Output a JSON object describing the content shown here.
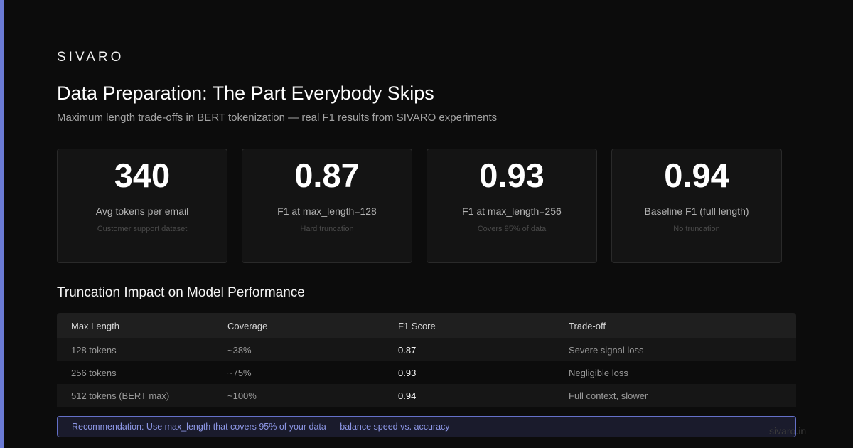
{
  "brand": "SIVARO",
  "title": "Data Preparation: The Part Everybody Skips",
  "subtitle": "Maximum length trade-offs in BERT tokenization — real F1 results from SIVARO experiments",
  "accent_color": "#6b7bd6",
  "stats": [
    {
      "value": "340",
      "label": "Avg tokens per email",
      "note": "Customer support dataset"
    },
    {
      "value": "0.87",
      "label": "F1 at max_length=128",
      "note": "Hard truncation"
    },
    {
      "value": "0.93",
      "label": "F1 at max_length=256",
      "note": "Covers 95% of data"
    },
    {
      "value": "0.94",
      "label": "Baseline F1 (full length)",
      "note": "No truncation"
    }
  ],
  "section_title": "Truncation Impact on Model Performance",
  "table": {
    "headers": [
      "Max Length",
      "Coverage",
      "F1 Score",
      "Trade-off"
    ],
    "rows": [
      [
        "128 tokens",
        "~38%",
        "0.87",
        "Severe signal loss"
      ],
      [
        "256 tokens",
        "~75%",
        "0.93",
        "Negligible loss"
      ],
      [
        "512 tokens (BERT max)",
        "~100%",
        "0.94",
        "Full context, slower"
      ]
    ]
  },
  "recommendation": "Recommendation: Use max_length that covers 95% of your data — balance speed vs. accuracy",
  "domain": "sivaro.in"
}
